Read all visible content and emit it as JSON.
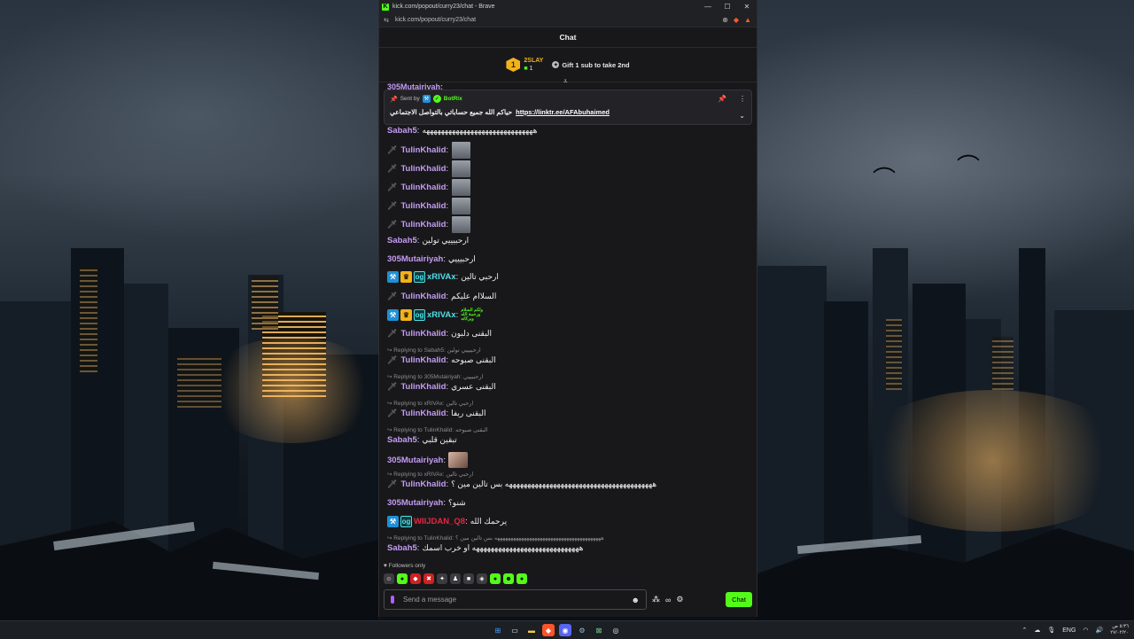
{
  "browser": {
    "title": "kick.com/popout/curry23/chat - Brave",
    "url": "kick.com/popout/curry23/chat",
    "minimize": "—",
    "maximize": "☐",
    "close": "✕"
  },
  "chat": {
    "header": "Chat",
    "leaderboard": {
      "rank": "1",
      "name": "2SLAY",
      "count": "1",
      "gift_prompt": "Gift 1 sub to take 2nd"
    },
    "pinned": {
      "sent_by": "Sent by",
      "bot_name": "BotRix",
      "message": "حياكم الله جميع حساباتي بالتواصل الاجتماعي",
      "link": "https://linktr.ee/AFAbuhaimed"
    },
    "cutoff_user": "305Mutairiyah:",
    "messages": [
      {
        "user": "Sabah5",
        "text": "ههههههههههههههههههههههههههههههه"
      },
      {
        "user": "TulinKhalid",
        "text": ""
      },
      {
        "user": "TulinKhalid",
        "text": ""
      },
      {
        "user": "TulinKhalid",
        "text": ""
      },
      {
        "user": "TulinKhalid",
        "text": ""
      },
      {
        "user": "TulinKhalid",
        "text": ""
      },
      {
        "user": "Sabah5",
        "text": "ارحبيييي تولين"
      },
      {
        "user": "305Mutairiyah",
        "text": "ارحبيييي"
      },
      {
        "user": "xRIVAx",
        "text": "ارحبي تالين"
      },
      {
        "user": "TulinKhalid",
        "text": "السلاام عليكم"
      },
      {
        "user": "xRIVAx",
        "text": ""
      },
      {
        "user": "TulinKhalid",
        "text": "البقنى دلبون"
      },
      {
        "user": "TulinKhalid",
        "text": "البقنى صبوحه"
      },
      {
        "user": "TulinKhalid",
        "text": "البقنى عسري"
      },
      {
        "user": "TulinKhalid",
        "text": "البقنى ريفا"
      },
      {
        "user": "Sabah5",
        "text": "تبقين قلبي"
      },
      {
        "user": "305Mutairiyah",
        "text": ""
      },
      {
        "user": "TulinKhalid",
        "text": "ههههههههههههههههههههههههههههههههههههههههه بس تالين مين ؟"
      },
      {
        "user": "305Mutairiyah",
        "text": "شنو؟"
      },
      {
        "user": "WIIJDAN_Q8",
        "text": "يرحمك الله"
      },
      {
        "user": "Sabah5",
        "text": "هههههههههههههههههههههههههههههه او خرب اسمك"
      }
    ],
    "replies": [
      {
        "to": "Replying to Sabah5:",
        "text": "ارحبيييي تولين"
      },
      {
        "to": "Replying to 305Mutairiyah:",
        "text": "ارحبيييي"
      },
      {
        "to": "Replying to xRIVAx:",
        "text": "ارحبي تالين"
      },
      {
        "to": "Replying to TulinKhalid:",
        "text": "البقنى صبوحه"
      },
      {
        "to": "Replying to xRIVAx:",
        "text": "ارحبي تالين"
      },
      {
        "to": "Replying to TulinKhalid:",
        "text": "ههههههههههههههههههههههههههههههههههههههههه بس تالين مين ؟"
      }
    ],
    "emote_green_text": "ولكم السلام ورحمة الله وبركاته",
    "followers_only": "Followers only",
    "input_placeholder": "Send a message",
    "infinity": "∞",
    "send_label": "Chat"
  },
  "taskbar": {
    "lang": "ENG",
    "time": "٥:٣٦ ص",
    "date": "٢٧/٠٢/٢٠"
  },
  "colors": {
    "kick_green": "#53fc18",
    "username_purple": "#c59cf4",
    "username_cyan": "#4fe0e8",
    "username_red": "#e8263e",
    "vip_gold": "#f2b21a"
  }
}
